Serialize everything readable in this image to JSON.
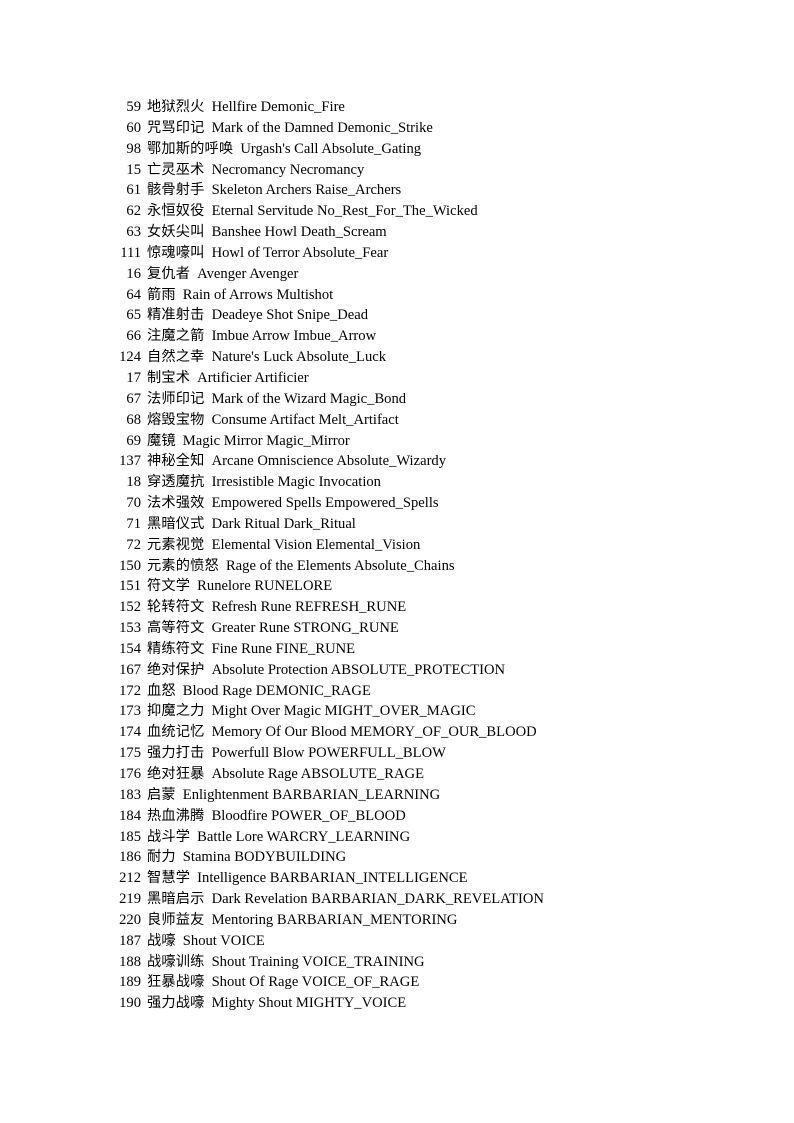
{
  "document": {
    "page_background": "#ffffff",
    "text_color": "#000000",
    "rows": [
      {
        "id": "59",
        "cn": "地狱烈火",
        "en": "Hellfire",
        "const": "Demonic_Fire"
      },
      {
        "id": "60",
        "cn": "咒骂印记",
        "en": "Mark of the Damned",
        "const": "Demonic_Strike"
      },
      {
        "id": "98",
        "cn": "鄂加斯的呼唤",
        "en": "Urgash's Call",
        "const": "Absolute_Gating"
      },
      {
        "id": "15",
        "cn": "亡灵巫术",
        "en": "Necromancy",
        "const": "Necromancy"
      },
      {
        "id": "61",
        "cn": "骸骨射手",
        "en": "Skeleton Archers",
        "const": "Raise_Archers"
      },
      {
        "id": "62",
        "cn": "永恒奴役",
        "en": "Eternal Servitude",
        "const": "No_Rest_For_The_Wicked"
      },
      {
        "id": "63",
        "cn": "女妖尖叫",
        "en": "Banshee Howl",
        "const": "Death_Scream"
      },
      {
        "id": "111",
        "cn": "惊魂嚎叫",
        "en": "Howl of Terror",
        "const": "Absolute_Fear"
      },
      {
        "id": "16",
        "cn": "复仇者",
        "en": "Avenger",
        "const": "Avenger"
      },
      {
        "id": "64",
        "cn": "箭雨",
        "en": "Rain of Arrows",
        "const": "Multishot"
      },
      {
        "id": "65",
        "cn": "精准射击",
        "en": "Deadeye Shot",
        "const": "Snipe_Dead"
      },
      {
        "id": "66",
        "cn": "注魔之箭",
        "en": "Imbue Arrow",
        "const": "Imbue_Arrow"
      },
      {
        "id": "124",
        "cn": "自然之幸",
        "en": "Nature's Luck",
        "const": "Absolute_Luck"
      },
      {
        "id": "17",
        "cn": "制宝术",
        "en": "Artificier",
        "const": "Artificier"
      },
      {
        "id": "67",
        "cn": "法师印记",
        "en": "Mark of the Wizard",
        "const": "Magic_Bond"
      },
      {
        "id": "68",
        "cn": "熔毁宝物",
        "en": "Consume Artifact",
        "const": "Melt_Artifact"
      },
      {
        "id": "69",
        "cn": "魔镜",
        "en": "Magic Mirror",
        "const": "Magic_Mirror"
      },
      {
        "id": "137",
        "cn": "神秘全知",
        "en": "Arcane Omniscience",
        "const": "Absolute_Wizardy"
      },
      {
        "id": "18",
        "cn": "穿透魔抗",
        "en": "Irresistible Magic",
        "const": "Invocation"
      },
      {
        "id": "70",
        "cn": "法术强效",
        "en": "Empowered Spells",
        "const": "Empowered_Spells"
      },
      {
        "id": "71",
        "cn": "黑暗仪式",
        "en": "Dark Ritual",
        "const": "Dark_Ritual"
      },
      {
        "id": "72",
        "cn": "元素视觉",
        "en": "Elemental Vision",
        "const": "Elemental_Vision"
      },
      {
        "id": "150",
        "cn": "元素的愤怒",
        "en": "Rage of the Elements",
        "const": "Absolute_Chains"
      },
      {
        "id": "151",
        "cn": "符文学",
        "en": "Runelore",
        "const": "RUNELORE"
      },
      {
        "id": "152",
        "cn": "轮转符文",
        "en": "Refresh Rune",
        "const": "REFRESH_RUNE"
      },
      {
        "id": "153",
        "cn": "高等符文",
        "en": "Greater Rune",
        "const": "STRONG_RUNE"
      },
      {
        "id": "154",
        "cn": "精练符文",
        "en": "Fine Rune",
        "const": "FINE_RUNE"
      },
      {
        "id": "167",
        "cn": "绝对保护",
        "en": "Absolute Protection",
        "const": "ABSOLUTE_PROTECTION"
      },
      {
        "id": "172",
        "cn": "血怒",
        "en": "Blood Rage",
        "const": "DEMONIC_RAGE"
      },
      {
        "id": "173",
        "cn": "抑魔之力",
        "en": "Might Over Magic",
        "const": "MIGHT_OVER_MAGIC"
      },
      {
        "id": "174",
        "cn": "血统记忆",
        "en": "Memory Of Our Blood",
        "const": "MEMORY_OF_OUR_BLOOD"
      },
      {
        "id": "175",
        "cn": "强力打击",
        "en": "Powerfull Blow",
        "const": "POWERFULL_BLOW"
      },
      {
        "id": "176",
        "cn": "绝对狂暴",
        "en": "Absolute Rage",
        "const": "ABSOLUTE_RAGE"
      },
      {
        "id": "183",
        "cn": "启蒙",
        "en": "Enlightenment",
        "const": "BARBARIAN_LEARNING"
      },
      {
        "id": "184",
        "cn": "热血沸腾",
        "en": "Bloodfire",
        "const": "POWER_OF_BLOOD"
      },
      {
        "id": "185",
        "cn": "战斗学",
        "en": "Battle Lore",
        "const": "WARCRY_LEARNING"
      },
      {
        "id": "186",
        "cn": "耐力",
        "en": "Stamina",
        "const": "BODYBUILDING"
      },
      {
        "id": "212",
        "cn": "智慧学",
        "en": "Intelligence",
        "const": "BARBARIAN_INTELLIGENCE"
      },
      {
        "id": "219",
        "cn": "黑暗启示",
        "en": "Dark Revelation",
        "const": "BARBARIAN_DARK_REVELATION"
      },
      {
        "id": "220",
        "cn": "良师益友",
        "en": "Mentoring",
        "const": "BARBARIAN_MENTORING"
      },
      {
        "id": "187",
        "cn": "战嚎",
        "en": "Shout",
        "const": "VOICE"
      },
      {
        "id": "188",
        "cn": "战嚎训练",
        "en": "Shout Training",
        "const": "VOICE_TRAINING"
      },
      {
        "id": "189",
        "cn": "狂暴战嚎",
        "en": "Shout Of Rage",
        "const": "VOICE_OF_RAGE"
      },
      {
        "id": "190",
        "cn": "强力战嚎",
        "en": "Mighty Shout",
        "const": "MIGHTY_VOICE"
      }
    ]
  }
}
